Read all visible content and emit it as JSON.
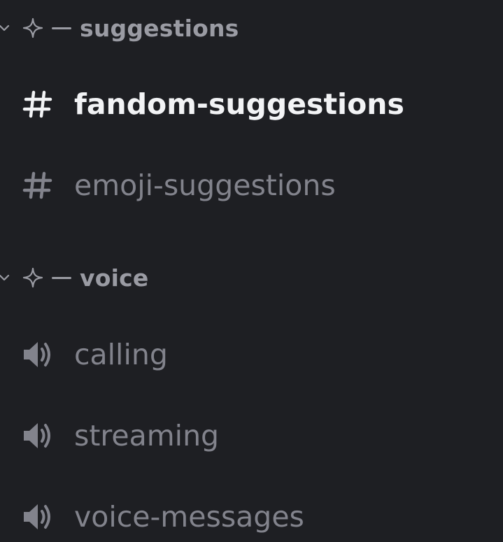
{
  "colors": {
    "background": "#1e1f23",
    "category_text": "#9a9ba3",
    "channel_text": "#82838c",
    "active_channel_text": "#f2f3f5"
  },
  "categories": [
    {
      "label": "suggestions",
      "icon": "sparkle-icon",
      "channels": [
        {
          "label": "fandom-suggestions",
          "icon": "hash-icon",
          "active": true
        },
        {
          "label": "emoji-suggestions",
          "icon": "hash-icon",
          "active": false
        }
      ]
    },
    {
      "label": "voice",
      "icon": "sparkle-icon",
      "channels": [
        {
          "label": "calling",
          "icon": "speaker-icon",
          "active": false
        },
        {
          "label": "streaming",
          "icon": "speaker-icon",
          "active": false
        },
        {
          "label": "voice-messages",
          "icon": "speaker-icon",
          "active": false
        }
      ]
    }
  ]
}
